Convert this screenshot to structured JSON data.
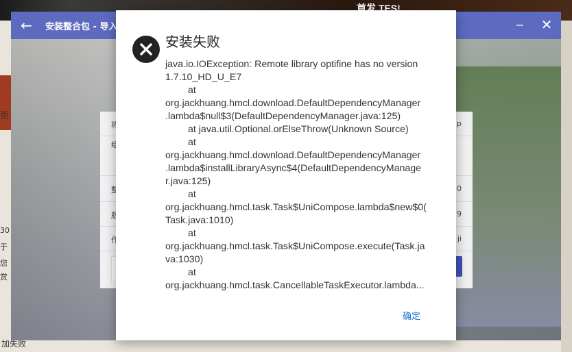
{
  "browser_background": {
    "ad_text": "首发 TES!",
    "left_fragments": [
      "页",
      "30",
      "于",
      "您",
      "赏"
    ],
    "bottom_text": "加失败"
  },
  "app": {
    "title": "安装整合包 - 导入",
    "back_icon": "arrow-left-icon",
    "minimize_icon": "minimize-icon",
    "close_icon": "close-icon",
    "accent_color": "#5c6bc0"
  },
  "install_card": {
    "rows": [
      {
        "label": "将",
        "value": "p"
      },
      {
        "label": "组",
        "value": ""
      },
      {
        "label": "整",
        "value": "0"
      },
      {
        "label": "版",
        "value": "9"
      },
      {
        "label": "作",
        "value": "ji"
      }
    ]
  },
  "error_dialog": {
    "icon": "error-circle-icon",
    "title": "安装失败",
    "lines": [
      {
        "text": "java.io.IOException: Remote library optifine has no version",
        "indent": false
      },
      {
        "text": "1.7.10_HD_U_E7",
        "indent": false
      },
      {
        "text": "at",
        "indent": true
      },
      {
        "text": "org.jackhuang.hmcl.download.DefaultDependencyManager",
        "indent": false
      },
      {
        "text": ".lambda$null$3(DefaultDependencyManager.java:125)",
        "indent": false
      },
      {
        "text": "at java.util.Optional.orElseThrow(Unknown Source)",
        "indent": true
      },
      {
        "text": "at",
        "indent": true
      },
      {
        "text": "org.jackhuang.hmcl.download.DefaultDependencyManager",
        "indent": false
      },
      {
        "text": ".lambda$installLibraryAsync$4(DefaultDependencyManage",
        "indent": false
      },
      {
        "text": "r.java:125)",
        "indent": false
      },
      {
        "text": "at",
        "indent": true
      },
      {
        "text": "org.jackhuang.hmcl.task.Task$UniCompose.lambda$new$0(",
        "indent": false
      },
      {
        "text": "Task.java:1010)",
        "indent": false
      },
      {
        "text": "at",
        "indent": true
      },
      {
        "text": "org.jackhuang.hmcl.task.Task$UniCompose.execute(Task.ja",
        "indent": false
      },
      {
        "text": "va:1030)",
        "indent": false
      },
      {
        "text": "at",
        "indent": true
      },
      {
        "text": "org.jackhuang.hmcl.task.CancellableTaskExecutor.lambda...",
        "indent": false
      }
    ],
    "ok_label": "确定",
    "ok_color": "#1976d2"
  }
}
